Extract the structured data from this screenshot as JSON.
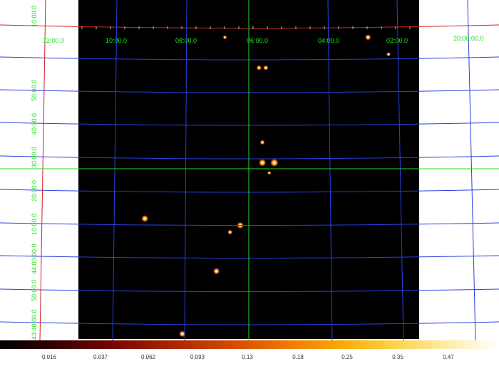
{
  "image": {
    "background": "#000000",
    "grid_color": "#2a3fe0",
    "crosshair_color": "#22dd22",
    "frame_color": "#cc2222"
  },
  "ra_labels": [
    "12:00.0",
    "10:00.0",
    "08:00.0",
    "06:00.0",
    "04:00.0",
    "02:00.0",
    "20:00:00.0"
  ],
  "dec_labels": [
    "10:00.0",
    "50:00.0",
    "40:00.0",
    "30:00.0",
    "20:00.0",
    "10:00.0",
    "44:00:00.0",
    "50:00.0",
    "43:40:00.0"
  ],
  "colorbar": {
    "ticks": [
      "0.016",
      "0.037",
      "0.062",
      "0.093",
      "0.13",
      "0.18",
      "0.25",
      "0.35",
      "0.47"
    ]
  },
  "sources": [
    {
      "ra_index": 0.43,
      "dec_index": 0.11,
      "brightness": 0.25
    },
    {
      "ra_index": 0.85,
      "dec_index": 0.11,
      "brightness": 0.6
    },
    {
      "ra_index": 0.91,
      "dec_index": 0.16,
      "brightness": 0.3
    },
    {
      "ra_index": 0.53,
      "dec_index": 0.2,
      "brightness": 0.45
    },
    {
      "ra_index": 0.55,
      "dec_index": 0.2,
      "brightness": 0.45
    },
    {
      "ra_index": 0.54,
      "dec_index": 0.42,
      "brightness": 0.4
    },
    {
      "ra_index": 0.54,
      "dec_index": 0.48,
      "brightness": 0.85
    },
    {
      "ra_index": 0.575,
      "dec_index": 0.48,
      "brightness": 1.0
    },
    {
      "ra_index": 0.195,
      "dec_index": 0.645,
      "brightness": 0.8
    },
    {
      "ra_index": 0.475,
      "dec_index": 0.665,
      "brightness": 0.75
    },
    {
      "ra_index": 0.445,
      "dec_index": 0.685,
      "brightness": 0.4
    },
    {
      "ra_index": 0.405,
      "dec_index": 0.8,
      "brightness": 0.7
    },
    {
      "ra_index": 0.305,
      "dec_index": 0.985,
      "brightness": 0.7
    },
    {
      "ra_index": 0.56,
      "dec_index": 0.51,
      "brightness": 0.2
    }
  ]
}
